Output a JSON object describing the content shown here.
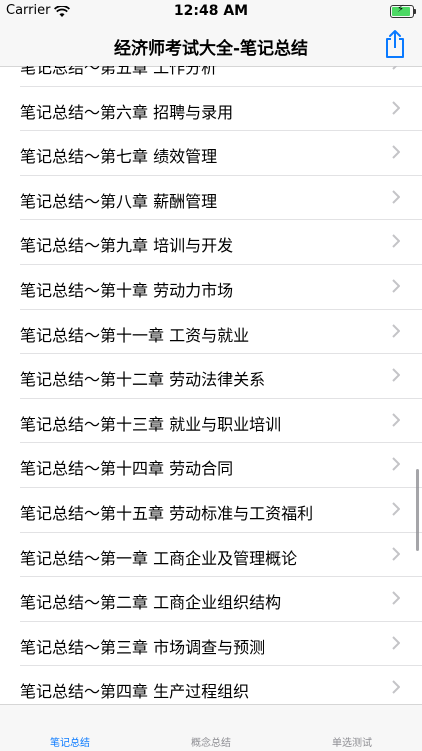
{
  "status_bar": {
    "carrier": "Carrier",
    "time": "12:48 AM"
  },
  "nav": {
    "title": "经济师考试大全-笔记总结"
  },
  "list": {
    "items": [
      "笔记总结～第五章 工作分析",
      "笔记总结～第六章 招聘与录用",
      "笔记总结～第七章 绩效管理",
      "笔记总结～第八章 薪酬管理",
      "笔记总结～第九章 培训与开发",
      "笔记总结～第十章 劳动力市场",
      "笔记总结～第十一章 工资与就业",
      "笔记总结～第十二章 劳动法律关系",
      "笔记总结～第十三章 就业与职业培训",
      "笔记总结～第十四章 劳动合同",
      "笔记总结～第十五章 劳动标准与工资福利",
      "笔记总结～第一章 工商企业及管理概论",
      "笔记总结～第二章 工商企业组织结构",
      "笔记总结～第三章 市场调查与预测",
      "笔记总结～第四章 生产过程组织"
    ]
  },
  "tabs": [
    {
      "label": "笔记总结"
    },
    {
      "label": "概念总结"
    },
    {
      "label": "单选测试"
    }
  ],
  "colors": {
    "accent": "#0a7aff",
    "inactive": "#8e8e93",
    "battery": "#4cd964"
  }
}
